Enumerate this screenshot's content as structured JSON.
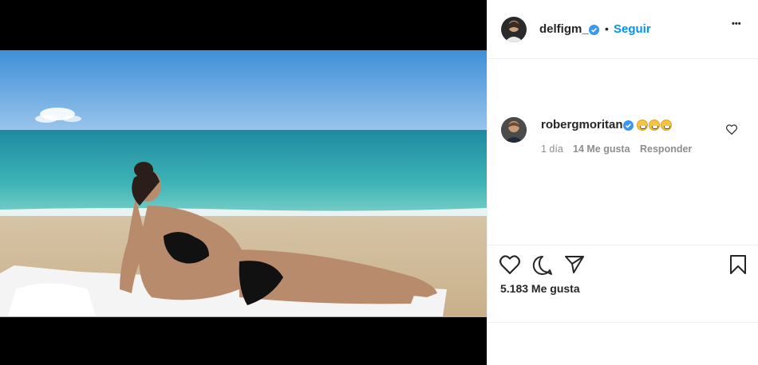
{
  "header": {
    "username": "delfigm_",
    "separator": "•",
    "follow_label": "Seguir",
    "more_label": "•••",
    "icons": {
      "avatar": "profile-avatar",
      "verified": "verified-badge-icon",
      "more": "more-options-icon"
    }
  },
  "comment": {
    "username": "robergmoritan",
    "emoji_count": 3,
    "emoji_name": "grinning-face-emoji",
    "time": "1 día",
    "likes": "14 Me gusta",
    "reply_label": "Responder",
    "icons": {
      "like": "heart-outline-icon",
      "verified": "verified-badge-icon"
    }
  },
  "actions": {
    "icons": [
      "heart-icon",
      "comment-icon",
      "share-icon",
      "bookmark-icon"
    ],
    "likes_label": "5.183 Me gusta"
  },
  "colors": {
    "accent": "#0095f6",
    "text": "#262626",
    "muted": "#8e8e8e",
    "divider": "#efefef",
    "verified": "#3897f0"
  }
}
